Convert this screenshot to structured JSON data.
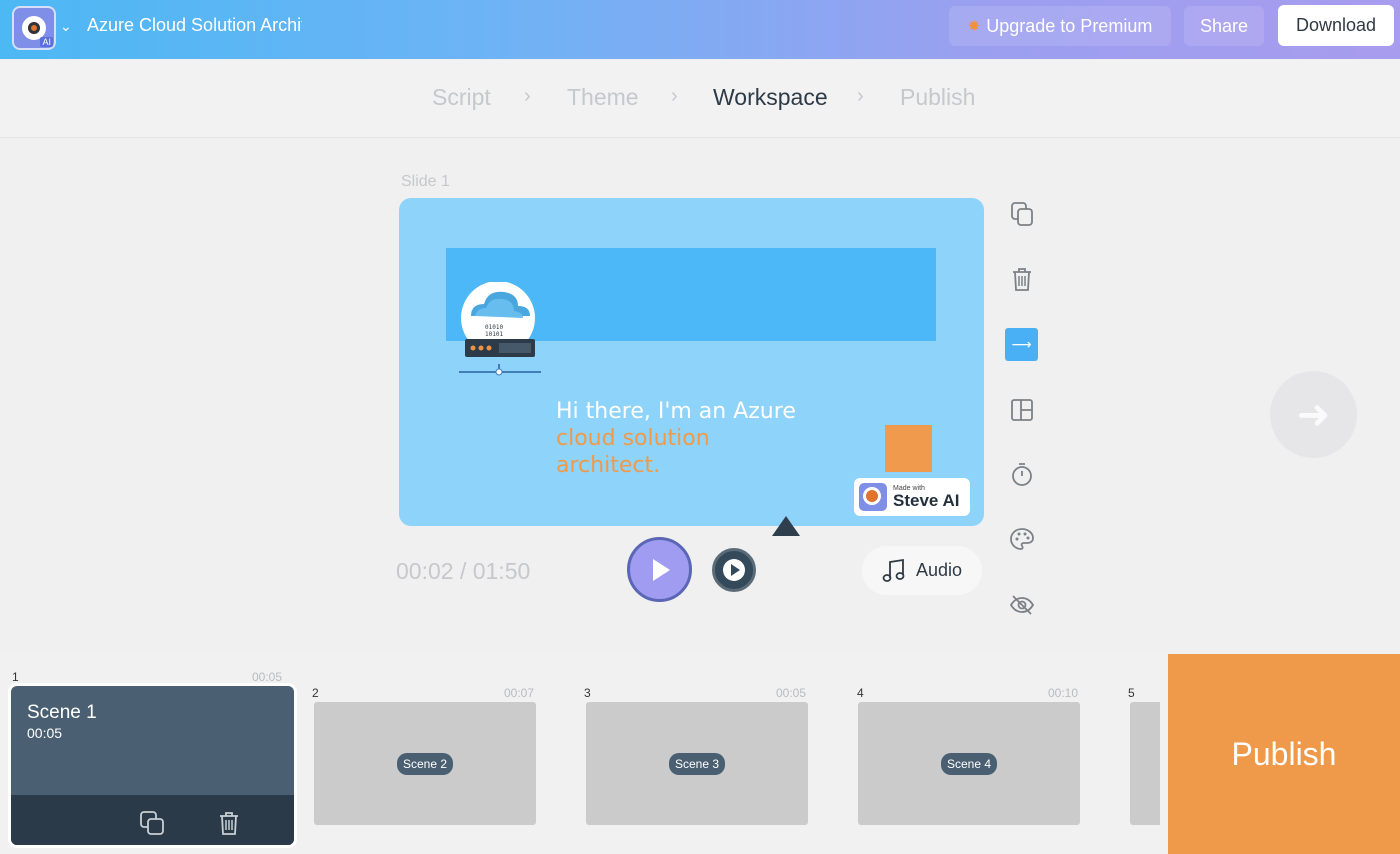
{
  "header": {
    "project_title": "Azure Cloud Solution Architect",
    "upgrade_label": "Upgrade to Premium",
    "share_label": "Share",
    "download_label": "Download",
    "logo_badge": "AI"
  },
  "steps": [
    {
      "label": "Script",
      "active": false
    },
    {
      "label": "Theme",
      "active": false
    },
    {
      "label": "Workspace",
      "active": true
    },
    {
      "label": "Publish",
      "active": false
    }
  ],
  "slide": {
    "label": "Slide 1",
    "line1": "Hi there, I'm an Azure",
    "line2": "cloud solution",
    "line3": "architect.",
    "badge_made": "Made with",
    "badge_brand": "Steve AI"
  },
  "player": {
    "time": "00:02 / 01:50",
    "audio_label": "Audio"
  },
  "timeline": {
    "scenes": [
      {
        "num": "1",
        "name": "Scene 1",
        "duration": "00:05"
      },
      {
        "num": "2",
        "name": "Scene 2",
        "duration": "00:07"
      },
      {
        "num": "3",
        "name": "Scene 3",
        "duration": "00:05"
      },
      {
        "num": "4",
        "name": "Scene 4",
        "duration": "00:10"
      },
      {
        "num": "5"
      }
    ]
  },
  "publish_label": "Publish",
  "colors": {
    "accent_blue": "#4ab0f5",
    "publish_orange": "#ef9a4b",
    "slide_bg": "#8ed3fa",
    "play_purple": "#9f9cf2"
  },
  "icons": [
    "chevron-down-icon",
    "star-icon",
    "copy-icon",
    "trash-icon",
    "arrow-right-icon",
    "layout-icon",
    "timer-icon",
    "palette-icon",
    "eye-off-icon",
    "music-note-icon",
    "play-icon"
  ]
}
